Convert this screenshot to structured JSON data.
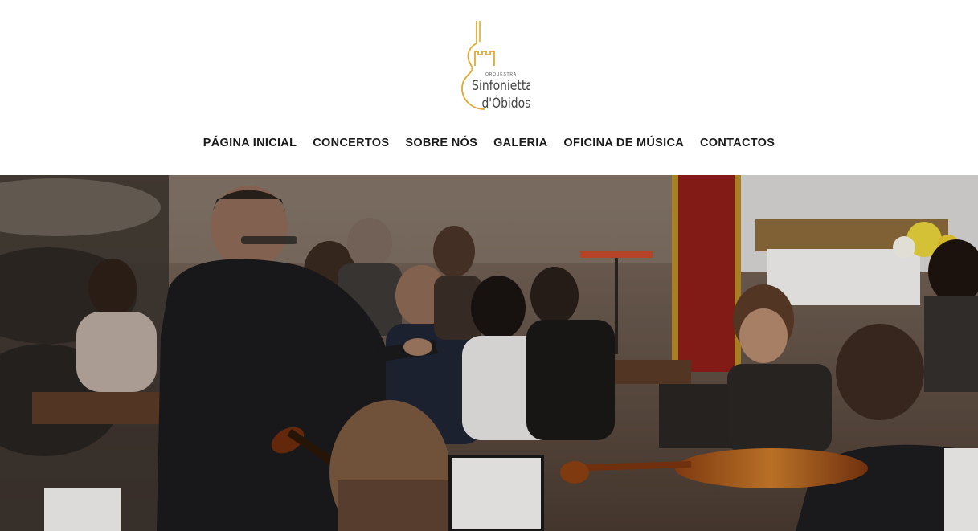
{
  "site": {
    "logo": {
      "small_text": "ORQUESTRA",
      "line1": "Sinfonietta",
      "line2": "d'Óbidos",
      "icon": "violin-castle-logo-icon",
      "color": "#E3A92D"
    }
  },
  "nav": {
    "items": [
      {
        "label": "PÁGINA INICIAL"
      },
      {
        "label": "CONCERTOS"
      },
      {
        "label": "SOBRE NÓS"
      },
      {
        "label": "GALERIA"
      },
      {
        "label": "OFICINA DE MÚSICA"
      },
      {
        "label": "CONTACTOS"
      }
    ]
  },
  "hero": {
    "image": "orchestra-concert-photo"
  }
}
